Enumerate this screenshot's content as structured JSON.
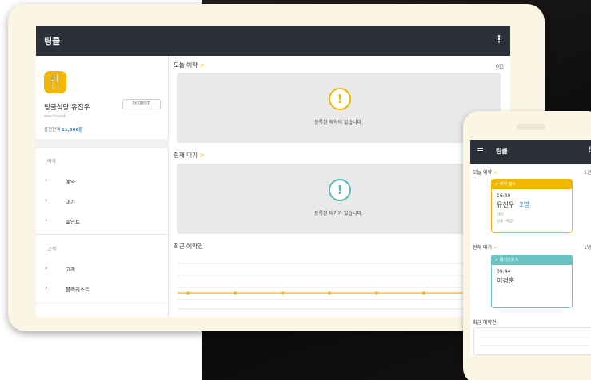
{
  "tablet": {
    "app_title": "팅클",
    "menu_icon": "more-vertical-icon",
    "sidebar": {
      "logo_icon": "utensils-icon",
      "store_name": "팅클식당 유진우",
      "store_id": "wecissoid",
      "balance_label": "충전잔액",
      "balance_value": "11,606원",
      "mypage_button": "마이페이지",
      "sections": [
        {
          "label": "예약",
          "items": [
            "예약",
            "대기",
            "포인트"
          ]
        },
        {
          "label": "고객",
          "items": [
            "고객",
            "블랙리스트"
          ]
        }
      ]
    },
    "main": {
      "reservations_title": "오늘 예약",
      "reservations_count": "0건",
      "reservations_empty": "등록된 예약이 없습니다.",
      "waiting_title": "현재 대기",
      "waiting_empty": "등록된 대기가 없습니다.",
      "recent_title": "최근 예약건",
      "chevron": ">"
    }
  },
  "phone": {
    "app_title": "팅클",
    "menu_icon": "hamburger-icon",
    "reservations_title": "오늘 예약",
    "reservations_count": "1건",
    "reservation_card": {
      "status": "예약 접수",
      "time": "16:40",
      "name": "유진우",
      "people": "2명",
      "note_label": "기타",
      "note_value": "팅클 (예정)"
    },
    "waiting_title": "현재 대기",
    "waiting_count": "1명",
    "waiting_card": {
      "status": "대기번호 6",
      "time": "09:44",
      "name": "이경훈"
    },
    "recent_title": "최근 예약건",
    "chevron": ">"
  },
  "colors": {
    "appbar": "#2b3038",
    "accent_yellow": "#f2b705",
    "accent_teal": "#6cc3c4",
    "empty_box": "#e9e9e9",
    "device_frame": "#fbf6e4"
  }
}
